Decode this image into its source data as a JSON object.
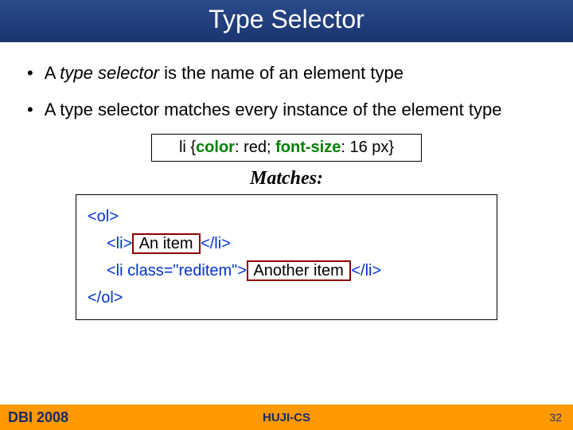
{
  "title": "Type Selector",
  "bullets": [
    {
      "pre": "A ",
      "em": "type selector",
      "post": " is the name of an element type"
    },
    {
      "pre": "A type selector matches every instance of the element type",
      "em": "",
      "post": ""
    }
  ],
  "code1": {
    "selector": "li {",
    "prop1": "color",
    "val1": ": red; ",
    "prop2": "font-size",
    "tail": ": 16 px}"
  },
  "matches_label": "Matches:",
  "code2": {
    "open_ol": "<ol>",
    "li1_open": "<li>",
    "li1_text": " An item ",
    "li1_close": "</li>",
    "li2_open": "<li class=\"reditem\">",
    "li2_text": " Another item ",
    "li2_close": "</li>",
    "close_ol": "</ol>"
  },
  "footer": {
    "left": "DBI 2008",
    "center": "HUJI-CS",
    "page": "32"
  }
}
